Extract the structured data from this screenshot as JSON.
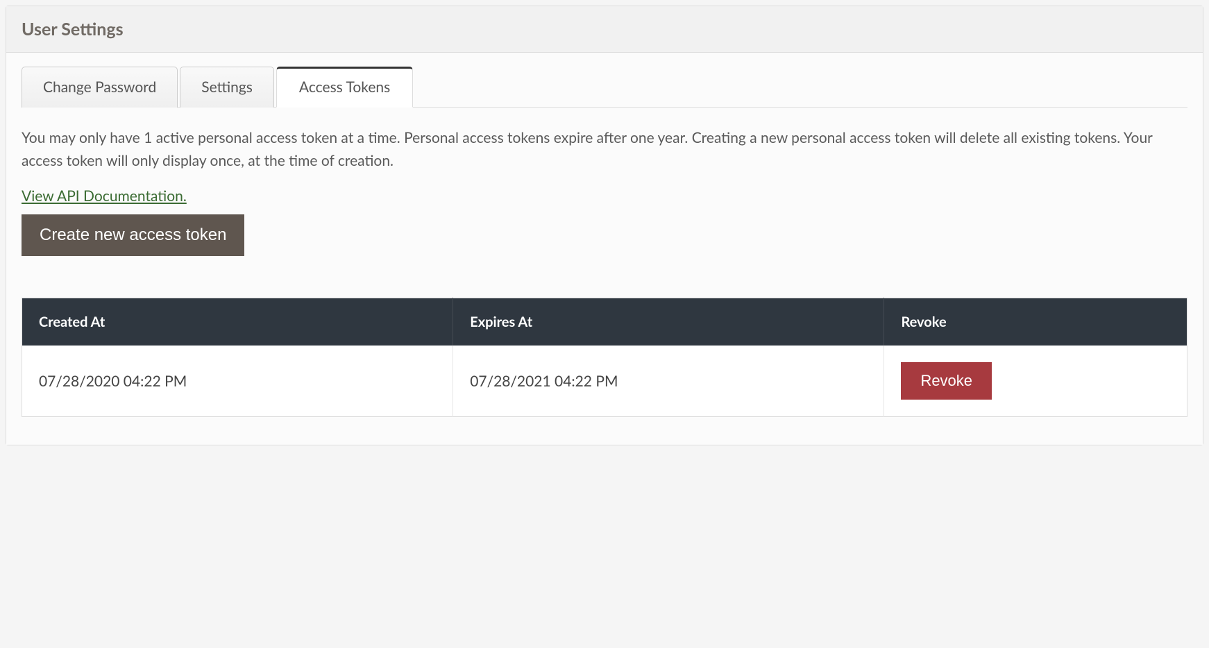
{
  "panel": {
    "title": "User Settings"
  },
  "tabs": {
    "change_password": "Change Password",
    "settings": "Settings",
    "access_tokens": "Access Tokens"
  },
  "access_tokens": {
    "description": "You may only have 1 active personal access token at a time. Personal access tokens expire after one year. Creating a new personal access token will delete all existing tokens. Your access token will only display once, at the time of creation.",
    "api_link_text": "View API Documentation.",
    "create_button_label": "Create new access token",
    "table": {
      "headers": {
        "created_at": "Created At",
        "expires_at": "Expires At",
        "revoke": "Revoke"
      },
      "rows": [
        {
          "created_at": "07/28/2020 04:22 PM",
          "expires_at": "07/28/2021 04:22 PM",
          "revoke_label": "Revoke"
        }
      ]
    }
  }
}
